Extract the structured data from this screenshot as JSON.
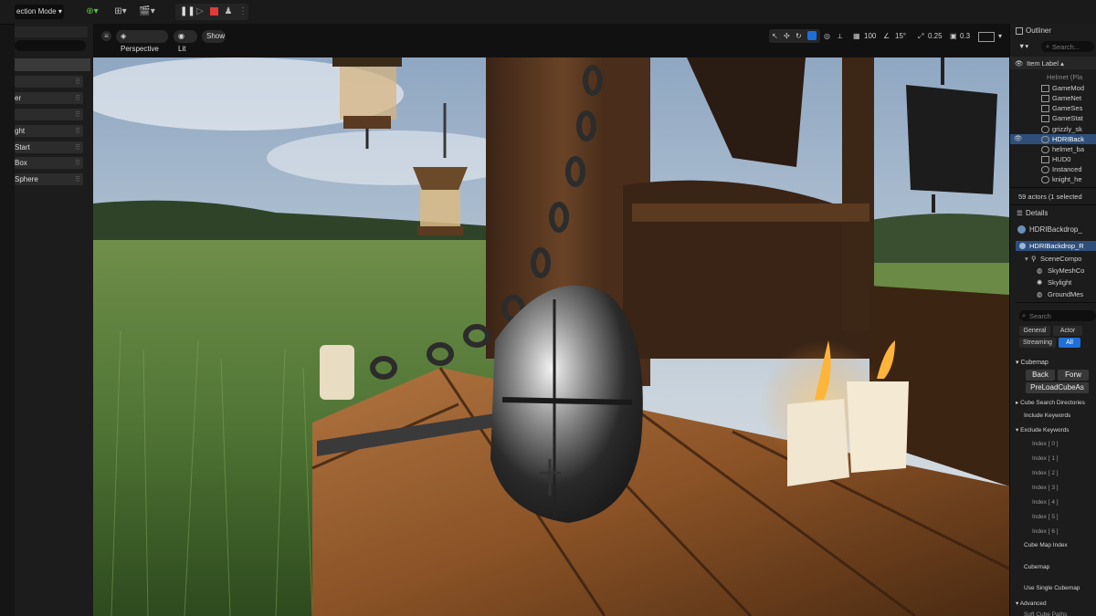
{
  "toolbar": {
    "mode_label": "ection Mode",
    "icons": [
      "add-actor-icon",
      "blueprint-icon",
      "cinematics-icon",
      "pause-icon",
      "advance-frame-icon",
      "stop-icon",
      "eject-icon",
      "more-options-icon"
    ]
  },
  "left_panel": {
    "items": [
      "",
      "er",
      "",
      "ght",
      "Start",
      "Box",
      "Sphere"
    ]
  },
  "viewport": {
    "perspective_label": "Perspective",
    "lit_label": "Lit",
    "show_label": "Show",
    "grid_value": "100",
    "angle_value": "15°",
    "scale_value": "0.25",
    "camera_speed": "0.3"
  },
  "outliner": {
    "title": "Outliner",
    "search_placeholder": "Search...",
    "column_label": "Item Label",
    "rows": [
      "Helmet (Pla",
      "GameMod",
      "GameNet",
      "GameSes",
      "GameStat",
      "grizzly_sk",
      "HDRIBack",
      "helmet_ba",
      "HUD0",
      "Instanced",
      "knight_he"
    ],
    "status": "59 actors (1 selected"
  },
  "details": {
    "title": "Details",
    "actor_name": "HDRIBackdrop_",
    "component_selected": "HDRIBackdrop_R",
    "components": [
      "SceneCompo",
      "SkyMeshCo",
      "Skylight",
      "GroundMes"
    ],
    "search_placeholder": "Search",
    "filters": [
      "General",
      "Actor",
      "Streaming",
      "All"
    ],
    "cubemap_section": "Cubemap",
    "cubemap_buttons": [
      "Back",
      "Forw"
    ],
    "preload_button": "PreLoadCubeAs",
    "cube_search_dirs": "Cube Search Directories",
    "include_keywords": "Include Keywords",
    "exclude_keywords": "Exclude Keywords",
    "indices": [
      "Index [ 0 ]",
      "Index [ 1 ]",
      "Index [ 2 ]",
      "Index [ 3 ]",
      "Index [ 4 ]",
      "Index [ 5 ]",
      "Index [ 6 ]"
    ],
    "cube_map_index": "Cube Map Index",
    "cubemap_label": "Cubemap",
    "use_single_cubemap": "Use Single Cubemap",
    "advanced": "Advanced",
    "last_row": "Soft Cube Paths"
  }
}
